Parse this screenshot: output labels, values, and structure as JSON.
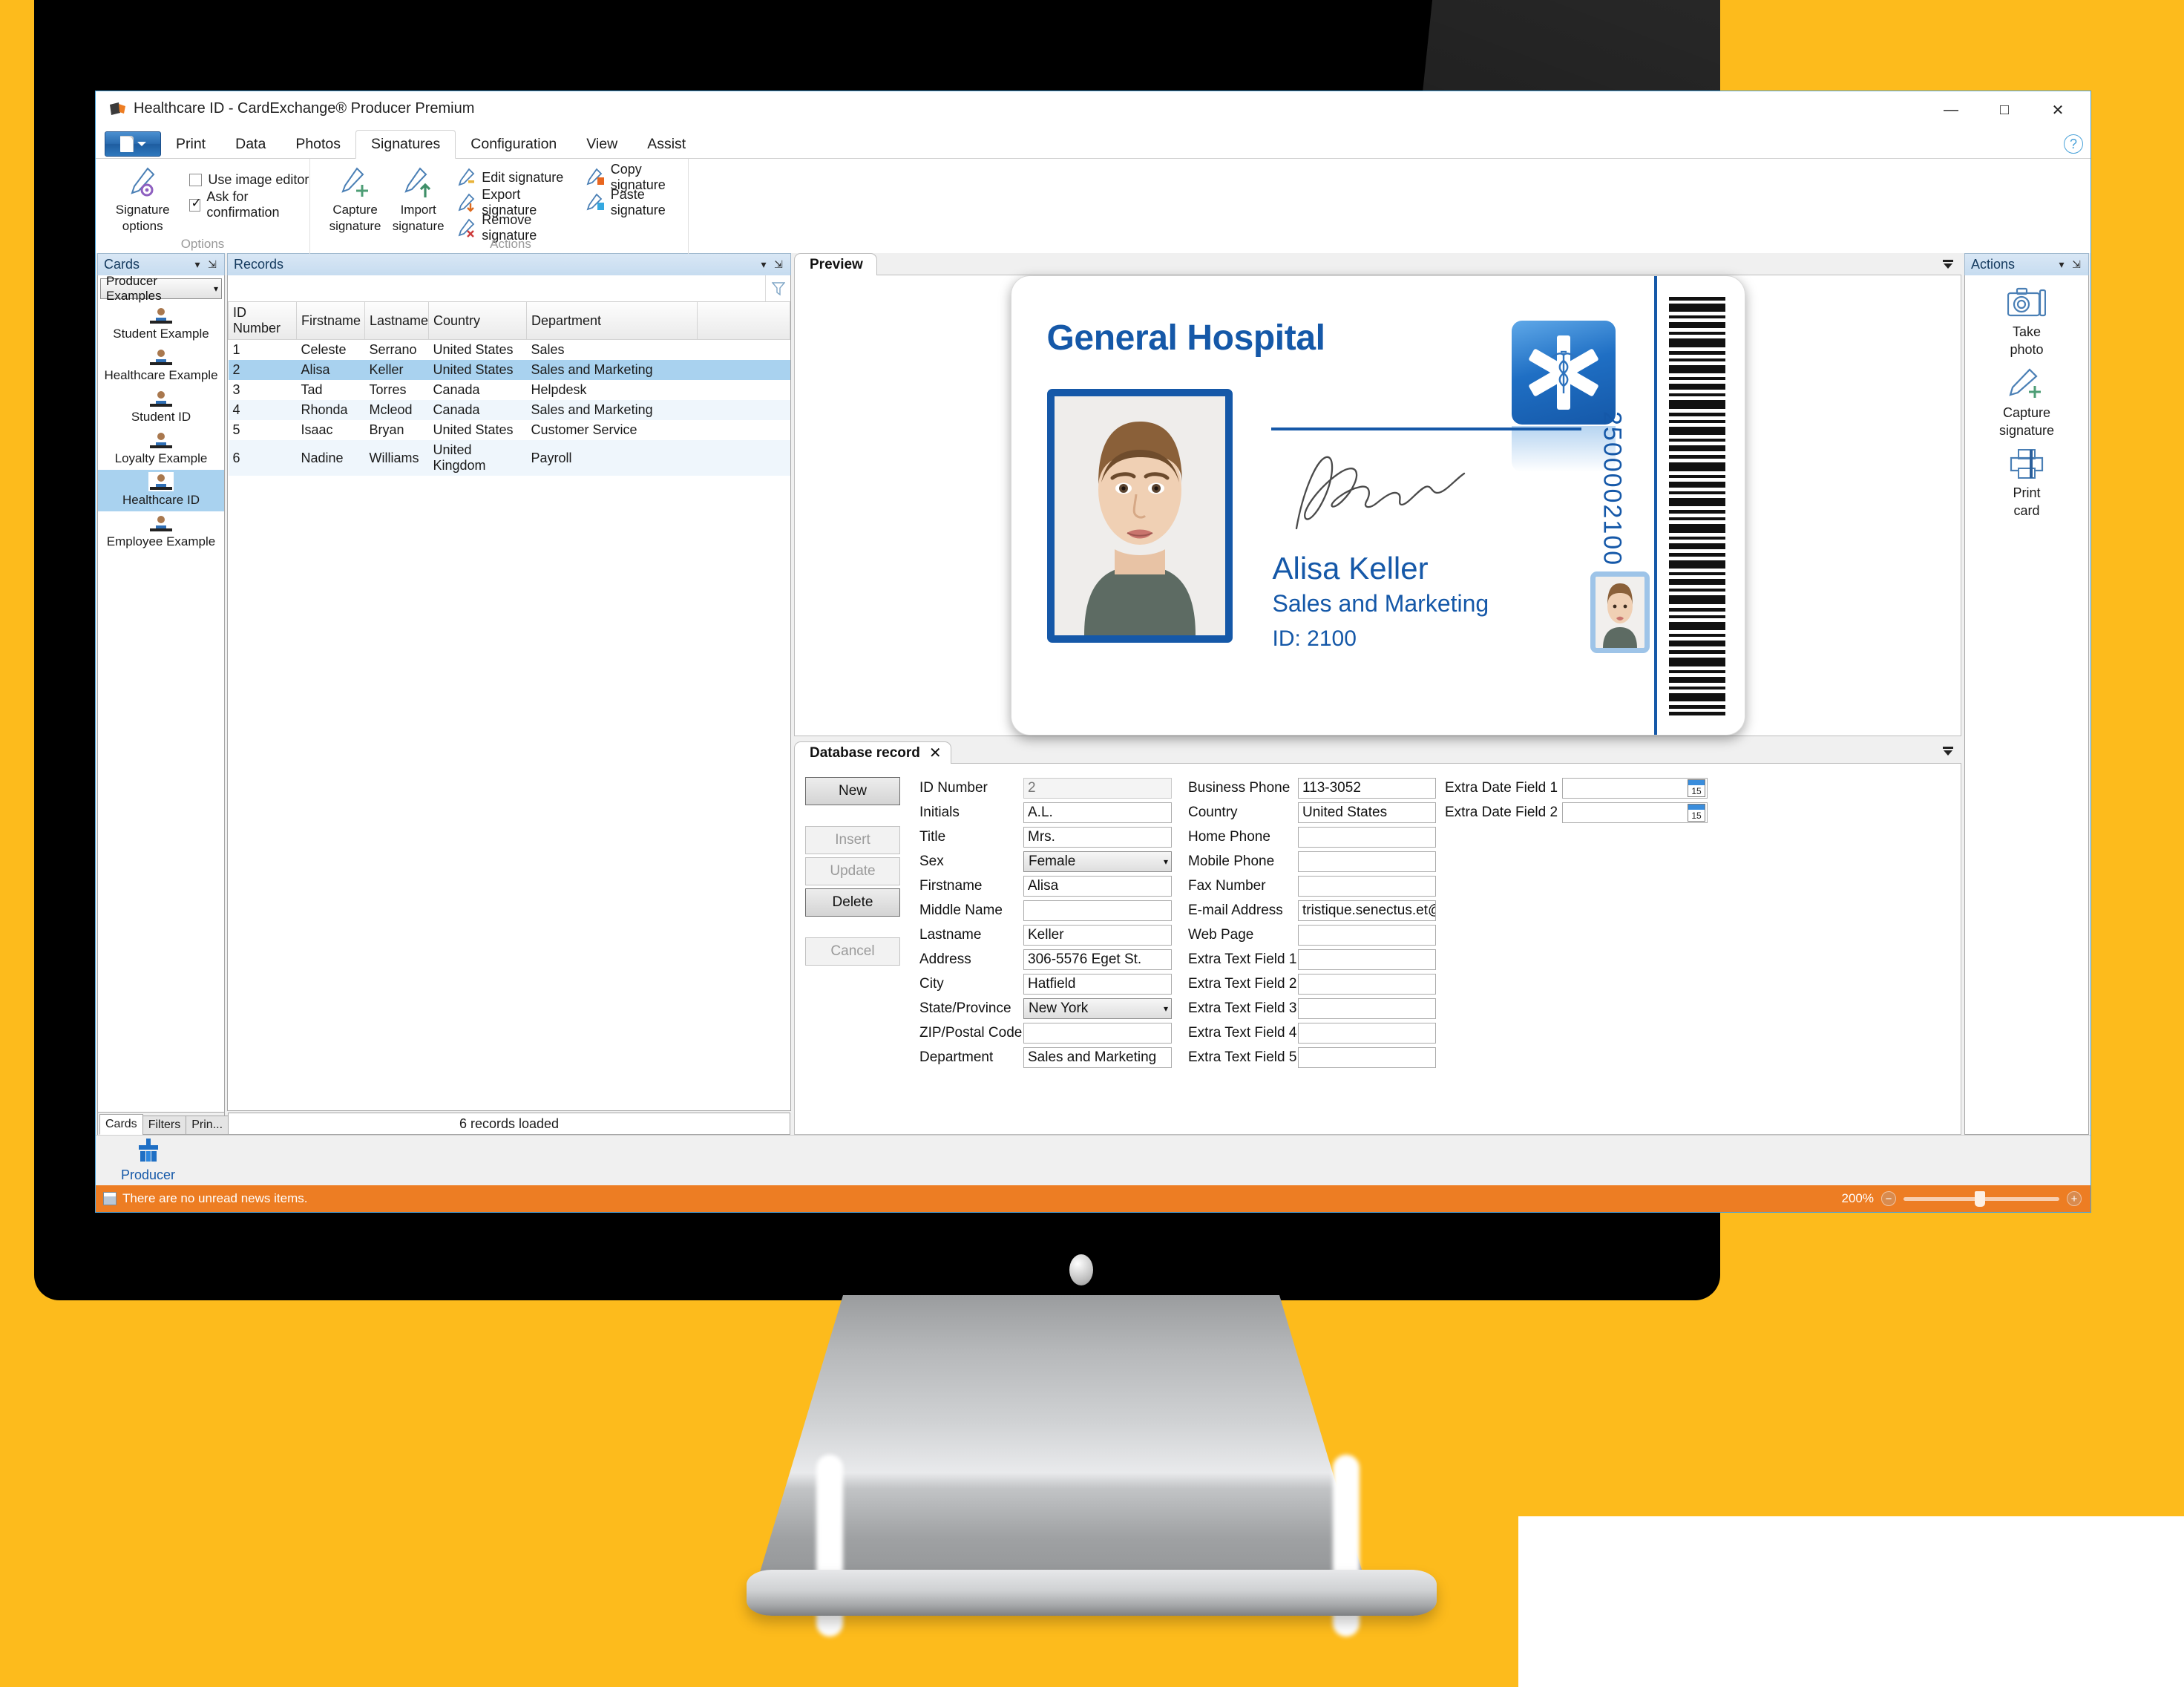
{
  "window": {
    "title": "Healthcare ID - CardExchange® Producer Premium",
    "minimize": "—",
    "maximize": "□",
    "close": "✕",
    "help": "?"
  },
  "ribbon": {
    "file_button": "file-menu",
    "tabs": [
      {
        "label": "Print",
        "active": false
      },
      {
        "label": "Data",
        "active": false
      },
      {
        "label": "Photos",
        "active": false
      },
      {
        "label": "Signatures",
        "active": true
      },
      {
        "label": "Configuration",
        "active": false
      },
      {
        "label": "View",
        "active": false
      },
      {
        "label": "Assist",
        "active": false
      }
    ],
    "groups": [
      {
        "name": "Options",
        "label": "Options",
        "big_button": "Signature\noptions",
        "big_button_line1": "Signature",
        "big_button_line2": "options",
        "checkboxes": [
          {
            "label": "Use image editor",
            "checked": false
          },
          {
            "label": "Ask for confirmation",
            "checked": true
          }
        ]
      },
      {
        "name": "Actions",
        "label": "Actions",
        "big_buttons": [
          {
            "line1": "Capture",
            "line2": "signature"
          },
          {
            "line1": "Import",
            "line2": "signature"
          }
        ],
        "small_buttons": [
          "Edit signature",
          "Export signature",
          "Remove signature",
          "Copy signature",
          "Paste signature"
        ]
      }
    ]
  },
  "cards_panel": {
    "title": "Cards",
    "combo_value": "Producer Examples",
    "items": [
      {
        "label": "Student Example",
        "selected": false
      },
      {
        "label": "Healthcare Example",
        "selected": false
      },
      {
        "label": "Student ID",
        "selected": false
      },
      {
        "label": "Loyalty Example",
        "selected": false
      },
      {
        "label": "Healthcare ID",
        "selected": true
      },
      {
        "label": "Employee Example",
        "selected": false
      }
    ],
    "tabs": [
      {
        "label": "Cards",
        "active": true
      },
      {
        "label": "Filters",
        "active": false
      },
      {
        "label": "Prin...",
        "active": false
      }
    ]
  },
  "records_panel": {
    "title": "Records",
    "search_value": "",
    "search_placeholder": "",
    "columns": [
      "ID Number",
      "Firstname",
      "Lastname",
      "Country",
      "Department"
    ],
    "rows": [
      {
        "id": "1",
        "firstname": "Celeste",
        "lastname": "Serrano",
        "country": "United States",
        "department": "Sales"
      },
      {
        "id": "2",
        "firstname": "Alisa",
        "lastname": "Keller",
        "country": "United States",
        "department": "Sales and Marketing"
      },
      {
        "id": "3",
        "firstname": "Tad",
        "lastname": "Torres",
        "country": "Canada",
        "department": "Helpdesk"
      },
      {
        "id": "4",
        "firstname": "Rhonda",
        "lastname": "Mcleod",
        "country": "Canada",
        "department": "Sales and Marketing"
      },
      {
        "id": "5",
        "firstname": "Isaac",
        "lastname": "Bryan",
        "country": "United States",
        "department": "Customer Service"
      },
      {
        "id": "6",
        "firstname": "Nadine",
        "lastname": "Williams",
        "country": "United Kingdom",
        "department": "Payroll"
      }
    ],
    "selected_row_index": 1,
    "status": "6 records loaded"
  },
  "preview": {
    "tab_label": "Preview",
    "card": {
      "organization": "General Hospital",
      "name": "Alisa Keller",
      "department": "Sales and Marketing",
      "id_line": "ID: 2100",
      "barcode_number": "2500002100",
      "accent_color": "#1558a8"
    }
  },
  "database_record": {
    "tab_label": "Database record",
    "tab_close": "✕",
    "buttons": [
      {
        "label": "New",
        "enabled": true
      },
      {
        "label": "Insert",
        "enabled": false
      },
      {
        "label": "Update",
        "enabled": false
      },
      {
        "label": "Delete",
        "enabled": true
      },
      {
        "label": "Cancel",
        "enabled": false
      }
    ],
    "column1": [
      {
        "label": "ID Number",
        "value": "2",
        "type": "text",
        "readonly": true
      },
      {
        "label": "Initials",
        "value": "A.L.",
        "type": "text"
      },
      {
        "label": "Title",
        "value": "Mrs.",
        "type": "text"
      },
      {
        "label": "Sex",
        "value": "Female",
        "type": "select"
      },
      {
        "label": "Firstname",
        "value": "Alisa",
        "type": "text"
      },
      {
        "label": "Middle Name",
        "value": "",
        "type": "text"
      },
      {
        "label": "Lastname",
        "value": "Keller",
        "type": "text"
      },
      {
        "label": "Address",
        "value": "306-5576 Eget St.",
        "type": "text"
      },
      {
        "label": "City",
        "value": "Hatfield",
        "type": "text"
      },
      {
        "label": "State/Province",
        "value": "New York",
        "type": "select"
      },
      {
        "label": "ZIP/Postal Code",
        "value": "",
        "type": "text"
      },
      {
        "label": "Department",
        "value": "Sales and Marketing",
        "type": "text"
      }
    ],
    "column2": [
      {
        "label": "Business Phone",
        "value": "113-3052",
        "type": "text"
      },
      {
        "label": "Country",
        "value": "United States",
        "type": "text"
      },
      {
        "label": "Home Phone",
        "value": "",
        "type": "text"
      },
      {
        "label": "Mobile Phone",
        "value": "",
        "type": "text"
      },
      {
        "label": "Fax Number",
        "value": "",
        "type": "text"
      },
      {
        "label": "E-mail Address",
        "value": "tristique.senectus.et@utmiD",
        "type": "text"
      },
      {
        "label": "Web Page",
        "value": "",
        "type": "text"
      },
      {
        "label": "Extra Text Field 1",
        "value": "",
        "type": "text"
      },
      {
        "label": "Extra Text Field 2",
        "value": "",
        "type": "text"
      },
      {
        "label": "Extra Text Field 3",
        "value": "",
        "type": "text"
      },
      {
        "label": "Extra Text Field 4",
        "value": "",
        "type": "text"
      },
      {
        "label": "Extra Text Field 5",
        "value": "",
        "type": "text"
      }
    ],
    "column3": [
      {
        "label": "Extra Date Field 1",
        "value": "",
        "type": "date"
      },
      {
        "label": "Extra Date Field 2",
        "value": "",
        "type": "date"
      }
    ]
  },
  "actions_panel": {
    "title": "Actions",
    "items": [
      {
        "icon": "camera-icon",
        "line1": "Take",
        "line2": "photo"
      },
      {
        "icon": "pen-plus-icon",
        "line1": "Capture",
        "line2": "signature"
      },
      {
        "icon": "printer-icon",
        "line1": "Print",
        "line2": "card"
      }
    ]
  },
  "navbar": {
    "producer_label": "Producer"
  },
  "statusbar": {
    "news_text": "There are no unread news items.",
    "zoom_level": "200%",
    "zoom_out": "−",
    "zoom_in": "+",
    "accent_color": "#ED7D23"
  }
}
